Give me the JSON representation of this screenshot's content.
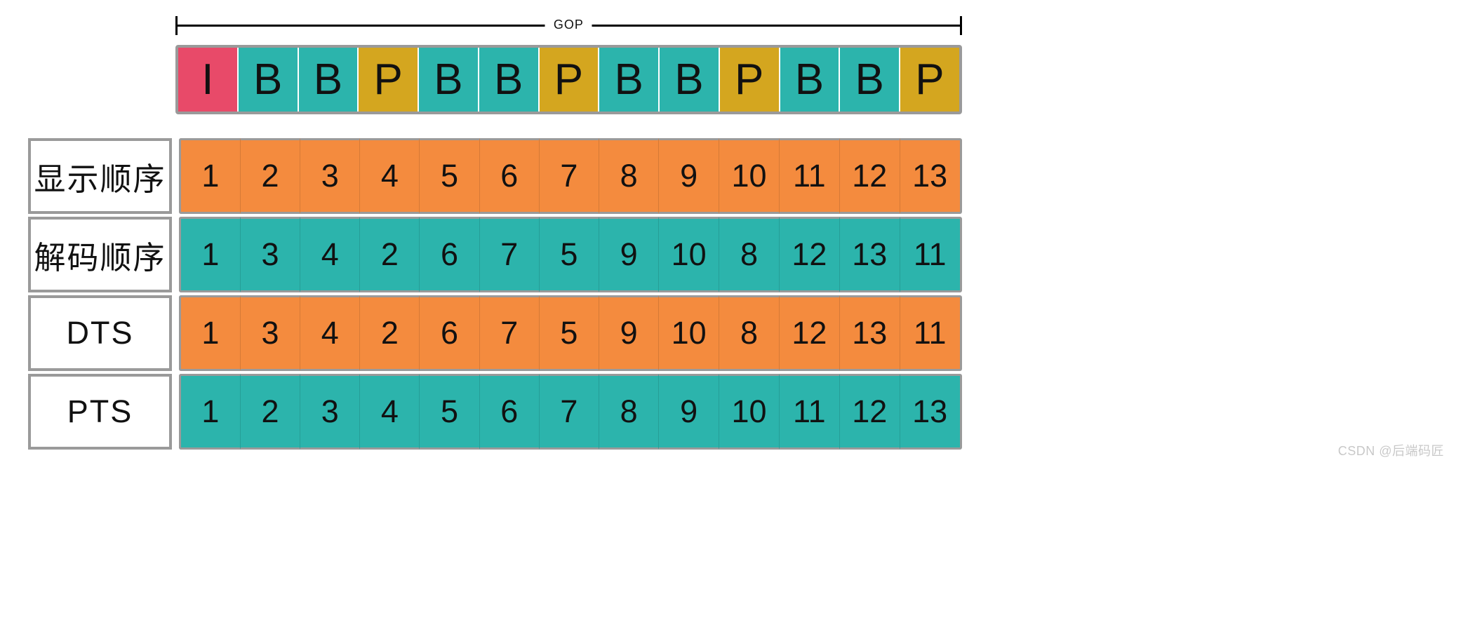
{
  "gop_label": "GOP",
  "frames": [
    {
      "type": "I",
      "label": "I"
    },
    {
      "type": "B",
      "label": "B"
    },
    {
      "type": "B",
      "label": "B"
    },
    {
      "type": "P",
      "label": "P"
    },
    {
      "type": "B",
      "label": "B"
    },
    {
      "type": "B",
      "label": "B"
    },
    {
      "type": "P",
      "label": "P"
    },
    {
      "type": "B",
      "label": "B"
    },
    {
      "type": "B",
      "label": "B"
    },
    {
      "type": "P",
      "label": "P"
    },
    {
      "type": "B",
      "label": "B"
    },
    {
      "type": "B",
      "label": "B"
    },
    {
      "type": "P",
      "label": "P"
    }
  ],
  "rows": [
    {
      "key": "display_order",
      "label": "显示顺序",
      "color": "orange",
      "values": [
        1,
        2,
        3,
        4,
        5,
        6,
        7,
        8,
        9,
        10,
        11,
        12,
        13
      ]
    },
    {
      "key": "decode_order",
      "label": "解码顺序",
      "color": "teal",
      "values": [
        1,
        3,
        4,
        2,
        6,
        7,
        5,
        9,
        10,
        8,
        12,
        13,
        11
      ]
    },
    {
      "key": "dts",
      "label": "DTS",
      "color": "orange",
      "values": [
        1,
        3,
        4,
        2,
        6,
        7,
        5,
        9,
        10,
        8,
        12,
        13,
        11
      ]
    },
    {
      "key": "pts",
      "label": "PTS",
      "color": "teal",
      "values": [
        1,
        2,
        3,
        4,
        5,
        6,
        7,
        8,
        9,
        10,
        11,
        12,
        13
      ]
    }
  ],
  "watermark": "CSDN @后端码匠",
  "chart_data": {
    "type": "table",
    "title": "GOP frame display vs decode order with DTS/PTS",
    "frame_types": [
      "I",
      "B",
      "B",
      "P",
      "B",
      "B",
      "P",
      "B",
      "B",
      "P",
      "B",
      "B",
      "P"
    ],
    "series": [
      {
        "name": "显示顺序",
        "values": [
          1,
          2,
          3,
          4,
          5,
          6,
          7,
          8,
          9,
          10,
          11,
          12,
          13
        ]
      },
      {
        "name": "解码顺序",
        "values": [
          1,
          3,
          4,
          2,
          6,
          7,
          5,
          9,
          10,
          8,
          12,
          13,
          11
        ]
      },
      {
        "name": "DTS",
        "values": [
          1,
          3,
          4,
          2,
          6,
          7,
          5,
          9,
          10,
          8,
          12,
          13,
          11
        ]
      },
      {
        "name": "PTS",
        "values": [
          1,
          2,
          3,
          4,
          5,
          6,
          7,
          8,
          9,
          10,
          11,
          12,
          13
        ]
      }
    ]
  }
}
